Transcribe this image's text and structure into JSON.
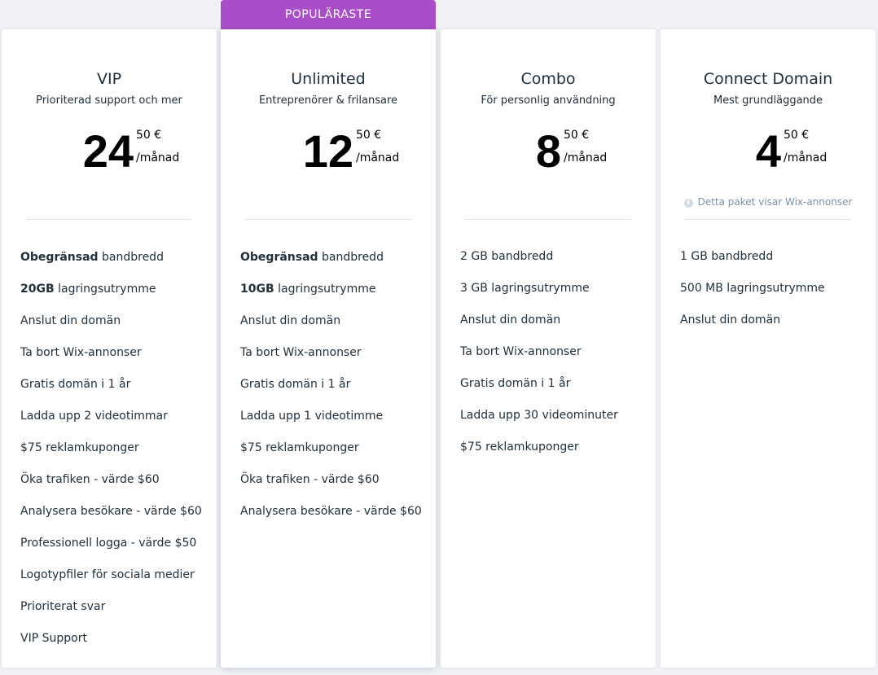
{
  "ribbon": "POPULÄRASTE",
  "plans": [
    {
      "name": "VIP",
      "tagline": "Prioriterad support och mer",
      "price_main": "24",
      "price_cents": "50 €",
      "price_period": "/månad",
      "features": [
        {
          "bold": "Obegränsad",
          "text": " bandbredd"
        },
        {
          "bold": "20GB",
          "text": " lagringsutrymme"
        },
        {
          "bold": "",
          "text": "Anslut din domän"
        },
        {
          "bold": "",
          "text": "Ta bort Wix-annonser"
        },
        {
          "bold": "",
          "text": "Gratis domän i 1 år"
        },
        {
          "bold": "",
          "text": "Ladda upp 2 videotimmar"
        },
        {
          "bold": "",
          "text": "$75 reklamkuponger"
        },
        {
          "bold": "",
          "text": "Öka trafiken - värde $60"
        },
        {
          "bold": "",
          "text": "Analysera besökare - värde $60"
        },
        {
          "bold": "",
          "text": "Professionell logga - värde $50"
        },
        {
          "bold": "",
          "text": "Logotypfiler för sociala medier"
        },
        {
          "bold": "",
          "text": "Prioriterat svar"
        },
        {
          "bold": "",
          "text": "VIP Support"
        }
      ]
    },
    {
      "name": "Unlimited",
      "tagline": "Entreprenörer & frilansare",
      "price_main": "12",
      "price_cents": "50 €",
      "price_period": "/månad",
      "features": [
        {
          "bold": "Obegränsad",
          "text": " bandbredd"
        },
        {
          "bold": "10GB",
          "text": " lagringsutrymme"
        },
        {
          "bold": "",
          "text": "Anslut din domän"
        },
        {
          "bold": "",
          "text": "Ta bort Wix-annonser"
        },
        {
          "bold": "",
          "text": "Gratis domän i 1 år"
        },
        {
          "bold": "",
          "text": "Ladda upp 1 videotimme"
        },
        {
          "bold": "",
          "text": "$75 reklamkuponger"
        },
        {
          "bold": "",
          "text": "Öka trafiken - värde $60"
        },
        {
          "bold": "",
          "text": "Analysera besökare - värde $60"
        }
      ]
    },
    {
      "name": "Combo",
      "tagline": "För personlig användning",
      "price_main": "8",
      "price_cents": "50 €",
      "price_period": "/månad",
      "features": [
        {
          "bold": "",
          "text": "2 GB bandbredd"
        },
        {
          "bold": "",
          "text": "3 GB lagringsutrymme"
        },
        {
          "bold": "",
          "text": "Anslut din domän"
        },
        {
          "bold": "",
          "text": "Ta bort Wix-annonser"
        },
        {
          "bold": "",
          "text": "Gratis domän i 1 år"
        },
        {
          "bold": "",
          "text": "Ladda upp 30 videominuter"
        },
        {
          "bold": "",
          "text": "$75 reklamkuponger"
        }
      ]
    },
    {
      "name": "Connect Domain",
      "tagline": "Mest grundläggande",
      "price_main": "4",
      "price_cents": "50 €",
      "price_period": "/månad",
      "ads_note": "Detta paket visar Wix-annonser",
      "features": [
        {
          "bold": "",
          "text": "1 GB bandbredd"
        },
        {
          "bold": "",
          "text": "500 MB lagringsutrymme"
        },
        {
          "bold": "",
          "text": "Anslut din domän"
        }
      ]
    }
  ],
  "colors": {
    "ribbon": "#aa4dc8",
    "background": "#f0f2f6",
    "card": "#ffffff",
    "text": "#20303c",
    "note": "#7a92a5"
  },
  "icons": {
    "ads_note_icon": "info-icon"
  }
}
